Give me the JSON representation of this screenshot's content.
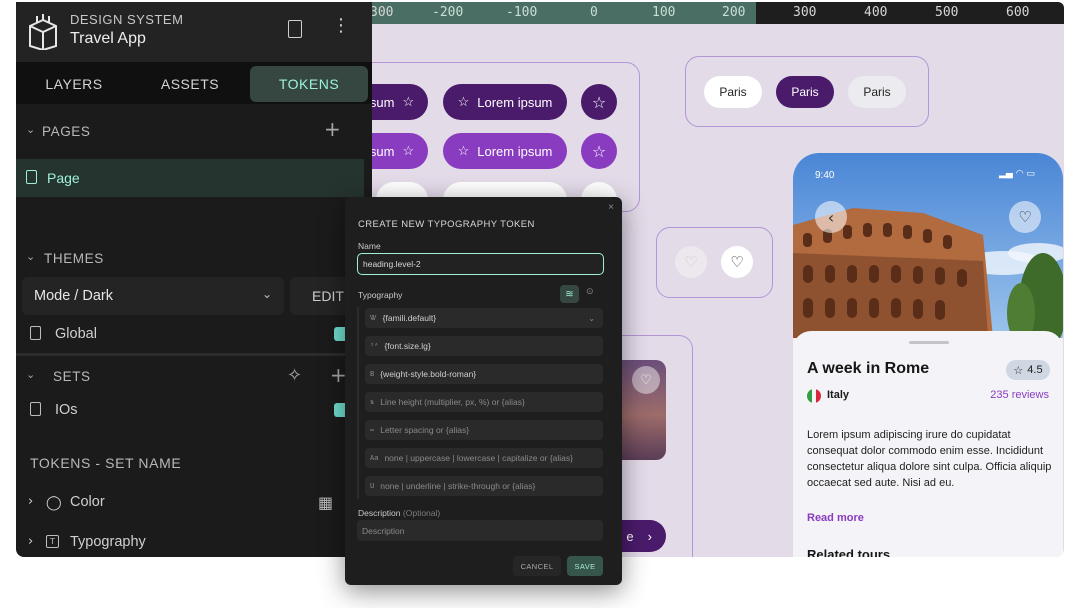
{
  "ruler": {
    "ticks": [
      "300",
      "-200",
      "-100",
      "0",
      "100",
      "200",
      "300",
      "400",
      "500",
      "600"
    ]
  },
  "canvas": {
    "pill_label": "Lorem ipsum",
    "pill_label_partial": "sum",
    "chips": [
      "Paris",
      "Paris",
      "Paris"
    ],
    "cta_partial": "e"
  },
  "phone": {
    "status_time": "9:40",
    "title": "A week in Rome",
    "rating": "4.5",
    "country": "Italy",
    "reviews": "235 reviews",
    "description": "Lorem ipsum adipiscing irure do cupidatat consequat dolor commodo enim esse. Incididunt consectetur aliqua dolore sint culpa. Officia aliquip occaecat sed aute. Nisi ad eu.",
    "read_more": "Read more",
    "related": "Related tours"
  },
  "sidebar": {
    "app_subtitle": "DESIGN SYSTEM",
    "app_title": "Travel App",
    "tabs": [
      "LAYERS",
      "ASSETS",
      "TOKENS"
    ],
    "pages_label": "PAGES",
    "page_item": "Page",
    "themes_label": "THEMES",
    "theme_select": "Mode / Dark",
    "edit_label": "EDIT",
    "global_label": "Global",
    "sets_label": "SETS",
    "ios_label": "IOs",
    "tokens_label": "TOKENS - SET NAME",
    "color_label": "Color",
    "typography_label": "Typography"
  },
  "modal": {
    "title": "CREATE NEW TYPOGRAPHY TOKEN",
    "name_label": "Name",
    "name_value": "heading.level-2",
    "typography_label": "Typography",
    "font_family": "{famili.default}",
    "font_size": "{font.size.lg}",
    "font_weight": "{weight-style.bold-roman}",
    "line_height_placeholder": "Line height (multiplier, px, %) or {alias}",
    "letter_spacing_placeholder": "Letter spacing or {alias}",
    "text_case_placeholder": "none | uppercase | lowercase | capitalize or {alias}",
    "text_decoration_placeholder": "none | underline | strike-through or {alias}",
    "description_label": "Description",
    "optional_label": "(Optional)",
    "description_placeholder": "Description",
    "cancel_label": "CANCEL",
    "save_label": "SAVE"
  },
  "colors": {
    "accent_teal": "#9ef0dc",
    "purple_dark": "#4a1b6b",
    "purple_mid": "#8a3cc0",
    "canvas_bg": "#e4dbe9"
  }
}
